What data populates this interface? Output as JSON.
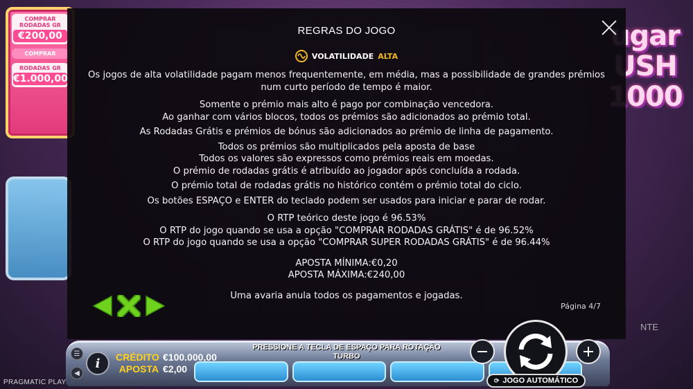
{
  "modal": {
    "title": "REGRAS DO JOGO",
    "volatility_label": "VOLATILIDADE",
    "volatility_level": "ALTA",
    "paragraphs": [
      "Os jogos de alta volatilidade pagam menos frequentemente, em média, mas a possibilidade de grandes prémios num curto período de tempo é maior.",
      "Somente o prémio mais alto é pago por combinação vencedora.",
      "Ao ganhar com vários blocos, todos os prémios são adicionados ao prémio total.",
      "As Rodadas Grátis e prémios de bónus são adicionados ao prémio de linha de pagamento.",
      "Todos os prémios são multiplicados pela aposta de base",
      "Todos os valores são expressos como prémios reais em moedas.",
      "O prémio de rodadas grátis é atribuído ao jogador após concluída a rodada.",
      "O prémio total de rodadas grátis no histórico contém o prémio total do ciclo.",
      "Os botões ESPAÇO e ENTER do teclado podem ser usados para iniciar e parar de rodar.",
      "O RTP teórico deste jogo é 96.53%",
      "O RTP do jogo quando se usa a opção \"COMPRAR RODADAS GRÁTIS\" é de 96.52%",
      "O RTP do jogo quando se usa a opção \"COMPRAR SUPER RODADAS GRÁTIS\" é de 96.44%",
      "APOSTA MÍNIMA:€0,20",
      "APOSTA MÁXIMA:€240,00",
      "Uma avaria anula todos os pagamentos e jogadas."
    ],
    "page_indicator": "Página 4/7"
  },
  "buy_panel": {
    "buy_free_spins_line1": "COMPRAR",
    "buy_free_spins_line2": "RODADAS GR",
    "buy_free_spins_price": "€200,00",
    "buy_super_label": "COMPRAR",
    "super_line": "RODADAS GR",
    "super_price": "€1.000,00"
  },
  "logo": {
    "line1": "ugar",
    "line2": "USH",
    "line3": "1000"
  },
  "bottom_bar": {
    "credit_label": "CRÉDITO",
    "credit_value": "€100.000,00",
    "bet_label": "APOSTA",
    "bet_value": "€2,00",
    "spin_hint_line1": "PRESSIONE A TECLA DE ESPAÇO PARA ROTAÇÃO",
    "spin_hint_line2": "TURBO",
    "autoplay_label": "JOGO AUTOMÁTICO",
    "right_label": "NTE"
  },
  "brand": "PRAGMATIC PLAY",
  "colors": {
    "accent_yellow": "#ffd21f",
    "volatility_orange": "#f2b81f",
    "nav_green": "#6fd21e",
    "modal_bg": "#0c0a0e"
  }
}
